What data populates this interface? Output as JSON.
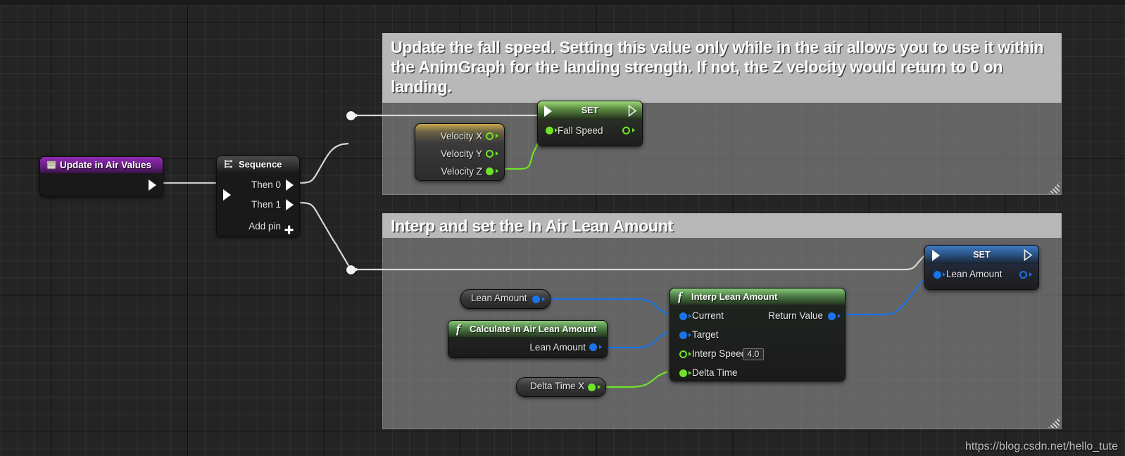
{
  "graph": {
    "background": "#242424",
    "grid_minor_color": "#2e2e2e",
    "grid_major_color": "#000000"
  },
  "comments": [
    {
      "id": "comment-fall-speed",
      "text": "Update the fall speed. Setting this value only while in the air allows you to use it within the AnimGraph for the landing strength. If not, the Z velocity would return to 0 on landing.",
      "header_color": "#b8b8b8",
      "body_color": "#8c8c8c"
    },
    {
      "id": "comment-lean-amount",
      "text": "Interp and set the In Air Lean Amount",
      "header_color": "#b8b8b8",
      "body_color": "#8c8c8c"
    }
  ],
  "nodes": {
    "update_in_air_values": {
      "title": "Update in Air Values",
      "icon": "function-event-icon",
      "header_color": "#7a2296",
      "exec_out": "exec-out-pin"
    },
    "sequence": {
      "title": "Sequence",
      "icon": "sequence-icon",
      "header_color": "#3a3a3a",
      "pins": [
        {
          "label": "Then 0",
          "type": "exec"
        },
        {
          "label": "Then 1",
          "type": "exec"
        }
      ],
      "add_pin_label": "Add pin"
    },
    "velocity": {
      "pins": [
        {
          "label": "Velocity X",
          "type": "float",
          "connected": false
        },
        {
          "label": "Velocity Y",
          "type": "float",
          "connected": false
        },
        {
          "label": "Velocity Z",
          "type": "float",
          "connected": true
        }
      ]
    },
    "set_fall_speed": {
      "title": "SET",
      "header_color": "#5e8d44",
      "pins": [
        {
          "label": "Fall Speed",
          "type": "float",
          "connected": true
        }
      ]
    },
    "lean_amount_get": {
      "label": "Lean Amount",
      "pin_type": "float-blue"
    },
    "calculate_in_air_lean_amount": {
      "title": "Calculate in Air Lean Amount",
      "icon": "function-icon",
      "header_color": "#4f7f47",
      "outputs": [
        {
          "label": "Lean Amount",
          "type": "float-blue"
        }
      ]
    },
    "delta_time_x": {
      "label": "Delta Time X",
      "pin_type": "float-green"
    },
    "interp_lean_amount": {
      "title": "Interp Lean Amount",
      "icon": "function-icon",
      "header_color": "#4f7f47",
      "inputs": [
        {
          "label": "Current",
          "type": "float-blue",
          "connected": true,
          "value": ""
        },
        {
          "label": "Target",
          "type": "float-blue",
          "connected": true,
          "value": ""
        },
        {
          "label": "Interp Speed",
          "type": "float-green",
          "connected": false,
          "value": "4.0"
        },
        {
          "label": "Delta Time",
          "type": "float-green",
          "connected": true,
          "value": ""
        }
      ],
      "outputs": [
        {
          "label": "Return Value",
          "type": "float-blue",
          "connected": true
        }
      ]
    },
    "set_lean_amount": {
      "title": "SET",
      "header_color": "#2d5b92",
      "pins": [
        {
          "label": "Lean Amount",
          "type": "float-blue",
          "connected": true
        }
      ]
    }
  },
  "watermark": "https://blog.csdn.net/hello_tute"
}
